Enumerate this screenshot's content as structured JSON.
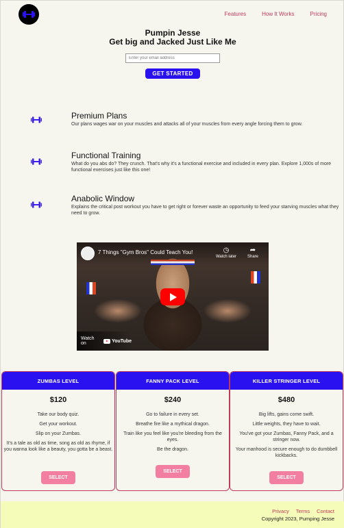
{
  "header": {
    "logo_icon": "dumbbell-icon",
    "nav": [
      "Features",
      "How It Works",
      "Pricing"
    ]
  },
  "hero": {
    "title": "Pumpin Jesse",
    "subtitle": "Get big and Jacked Just Like Me",
    "email_placeholder": "Enter your email address",
    "cta": "GET STARTED"
  },
  "features": [
    {
      "icon": "dumbbell-icon",
      "title": "Premium Plans",
      "text": "Our plans wages war on your muscles and attacks all of your muscles from every angle forcing them to grow."
    },
    {
      "icon": "dumbbell-icon",
      "title": "Functional Training",
      "text": "What do you abs do? They crunch. That's why it's a functional exercise and included in every plan. Explore 1,000s of more functional exercises just like this one!"
    },
    {
      "icon": "dumbbell-icon",
      "title": "Anabolic Window",
      "text": "Explains the critical post workout you have to get right or forever waste an opportunity to feed your starving muscles what they need to grow."
    }
  ],
  "video": {
    "title": "7 Things \"Gym Bros\" Could Teach You!",
    "watch_later": "Watch later",
    "share": "Share",
    "watch_on": "Watch on",
    "youtube": "YouTube"
  },
  "plans": [
    {
      "name": "ZUMBAS LEVEL",
      "price": "$120",
      "items": [
        "Take our body quiz.",
        "Get your workout.",
        "Slip on your Zumbas.",
        "It's a tale as old as time, song as old as rhyme, if you wanna look like a beauty, you gotta be a beast."
      ],
      "button": "SELECT"
    },
    {
      "name": "FANNY PACK LEVEL",
      "price": "$240",
      "items": [
        "Go to failure in every set.",
        "Breathe fire like a mythical dragon.",
        "Train like you feel like you're bleeding from the eyes.",
        "Be the dragon."
      ],
      "button": "SELECT"
    },
    {
      "name": "KILLER STRINGER LEVEL",
      "price": "$480",
      "items": [
        "Big lifts, gains come swift.",
        "Little weights, they have to wait.",
        "You've got your Zumbas, Fanny Pack, and a stringer now.",
        "Your manhood is secure enough to do dumbbell kickbacks."
      ],
      "button": "SELECT"
    }
  ],
  "footer": {
    "links": [
      "Privacy",
      "Terms",
      "Contact"
    ],
    "copyright": "Copyright 2023, Pumping Jesse"
  },
  "colors": {
    "brand_blue": "#2a12f0",
    "link_pink": "#c0395a",
    "button_pink": "#f27ea1",
    "footer_bg": "#f5fbb8"
  }
}
